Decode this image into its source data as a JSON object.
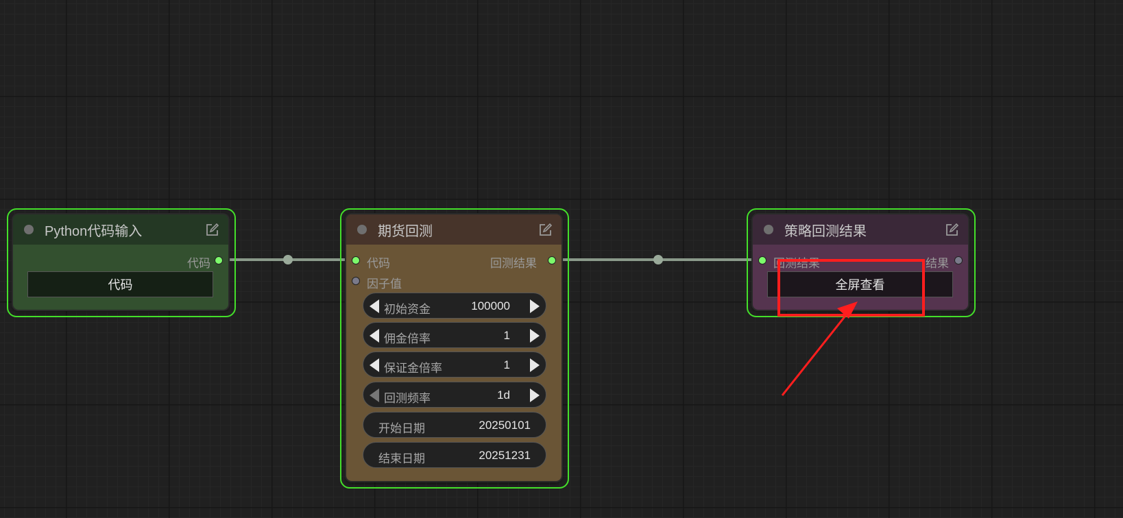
{
  "nodes": {
    "python_input": {
      "title": "Python代码输入",
      "output_label": "代码",
      "button_label": "代码"
    },
    "futures_backtest": {
      "title": "期货回测",
      "input_code_label": "代码",
      "input_factor_label": "因子值",
      "output_label": "回测结果",
      "widgets": [
        {
          "label": "初始资金",
          "value": "100000"
        },
        {
          "label": "佣金倍率",
          "value": "1"
        },
        {
          "label": "保证金倍率",
          "value": "1"
        },
        {
          "label": "回测频率",
          "value": "1d"
        },
        {
          "label": "开始日期",
          "value": "20250101"
        },
        {
          "label": "结束日期",
          "value": "20251231"
        }
      ]
    },
    "strategy_result": {
      "title": "策略回测结果",
      "input_label": "回测结果",
      "output_label": "结果",
      "button_label": "全屏查看"
    }
  },
  "colors": {
    "canvas": "#202020",
    "selection": "#44e02a",
    "python_header": "#243824",
    "python_body": "#33502f",
    "backtest_header": "#47342a",
    "backtest_body": "#6a5536",
    "result_header": "#3a2838",
    "result_body": "#55344f",
    "annotation": "#ff1e1e",
    "port_connected": "#7dfa6b"
  }
}
